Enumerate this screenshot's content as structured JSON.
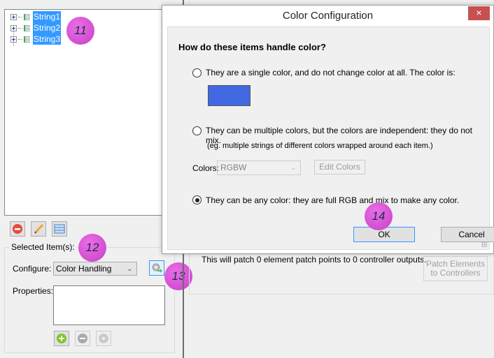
{
  "tree": {
    "items": [
      {
        "label": "String1"
      },
      {
        "label": "String2"
      },
      {
        "label": "String3"
      }
    ]
  },
  "annotations": [
    "11",
    "12",
    "13",
    "14"
  ],
  "toolbar": {
    "delete_icon": "delete-icon",
    "rename_icon": "pencil-icon",
    "grid_icon": "grid-icon"
  },
  "selected_group": {
    "title": "Selected Item(s):",
    "configure_label": "Configure:",
    "configure_value": "Color Handling",
    "properties_label": "Properties:"
  },
  "right_panel": {
    "patch_text": "This will patch 0 element patch points to 0 controller outputs.",
    "patch_button": "Patch Elements to Controllers"
  },
  "dialog": {
    "title": "Color Configuration",
    "close_label": "×",
    "question": "How do these items handle color?",
    "options": [
      {
        "label": "They are a single color, and do not change color at all. The color is:",
        "selected": false
      },
      {
        "label": "They can be multiple colors, but the colors are independent: they do not mix.",
        "selected": false,
        "note": "(eg. multiple strings of different colors wrapped around each item.)"
      },
      {
        "label": "They can be any color: they are full RGB and mix to make any color.",
        "selected": true
      }
    ],
    "single_color": "#4169e1",
    "colors_label": "Colors:",
    "colors_value": "RGBW",
    "edit_colors_label": "Edit Colors",
    "ok_label": "OK",
    "cancel_label": "Cancel"
  }
}
